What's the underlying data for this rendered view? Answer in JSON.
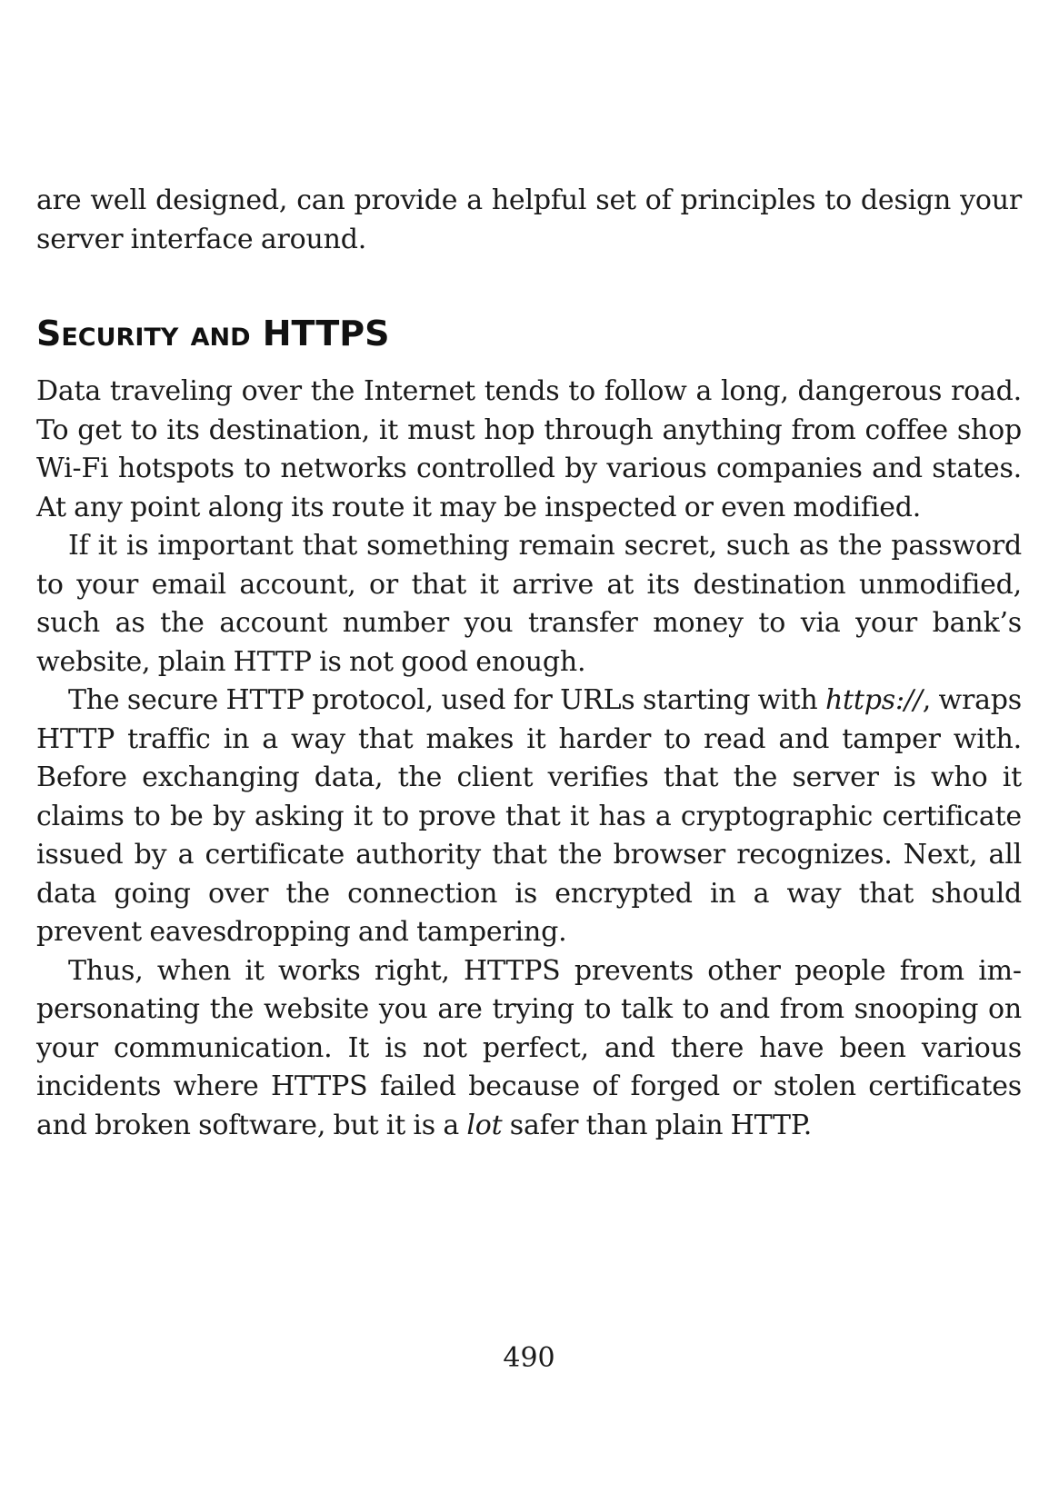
{
  "intro": {
    "text": "are well designed, can provide a helpful set of principles to design your server interface around."
  },
  "section": {
    "heading": "Security and HTTPS",
    "p1": "Data traveling over the Internet tends to follow a long, dangerous road. To get to its destination, it must hop through anything from coffee shop Wi-Fi hotspots to networks controlled by various companies and states. At any point along its route it may be inspected or even modified.",
    "p2": "If it is important that something remain secret, such as the password to your email account, or that it arrive at its destination unmodified, such as the account number you transfer money to via your bank’s website, plain HTTP is not good enough.",
    "p3_before": "The secure HTTP protocol, used for URLs starting with ",
    "p3_em": "https://",
    "p3_after": ", wraps HTTP traffic in a way that makes it harder to read and tamper with. Before exchanging data, the client verifies that the server is who it claims to be by asking it to prove that it has a cryptographic certificate issued by a certificate authority that the browser recognizes. Next, all data going over the connection is encrypted in a way that should prevent eavesdropping and tampering.",
    "p4_before": "Thus, when it works right, HTTPS prevents other people from im­personating the website you are trying to talk to and from snooping on your communication. It is not perfect, and there have been various incidents where HTTPS failed because of forged or stolen certificates and broken software, but it is a ",
    "p4_em": "lot",
    "p4_after": " safer than plain HTTP."
  },
  "footer": {
    "page_number": "490"
  }
}
